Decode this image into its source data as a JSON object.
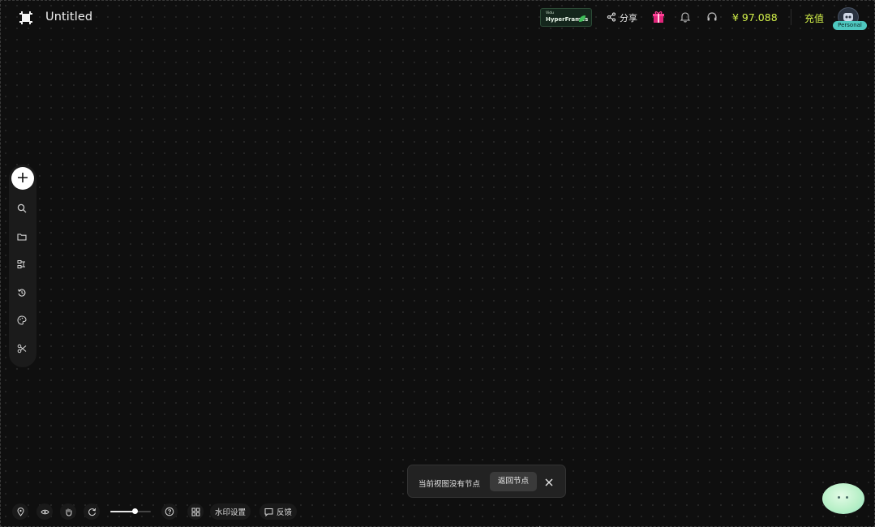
{
  "header": {
    "title": "Untitled",
    "promo": {
      "small_text": "Vidu",
      "big_text": "HyperFrames"
    },
    "share_label": "分享",
    "balance": "¥ 97.088",
    "recharge_label": "充值",
    "avatar_badge": "Personal"
  },
  "left_toolbar": {
    "items": [
      {
        "icon": "plus-icon"
      },
      {
        "icon": "search-icon"
      },
      {
        "icon": "folder-icon"
      },
      {
        "icon": "workflow-icon"
      },
      {
        "icon": "history-icon"
      },
      {
        "icon": "palette-icon"
      },
      {
        "icon": "scissors-icon"
      }
    ]
  },
  "bottom_toolbar": {
    "items": [
      {
        "icon": "map-pin-icon"
      },
      {
        "icon": "eye-icon"
      },
      {
        "icon": "hand-icon"
      },
      {
        "icon": "refresh-icon"
      },
      {
        "icon": "help-icon"
      },
      {
        "icon": "grid-icon"
      }
    ],
    "zoom_level": 0.6,
    "watermark_label": "水印设置",
    "feedback_label": "反馈"
  },
  "toast": {
    "message": "当前视图没有节点",
    "action_label": "返回节点"
  },
  "colors": {
    "background": "#0f0f0f",
    "accent": "#d4f24a",
    "badge": "#4ec8c0"
  }
}
